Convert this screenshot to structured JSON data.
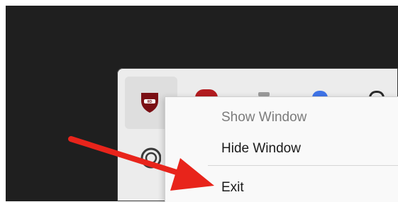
{
  "menu": {
    "items": [
      {
        "label": "Show Window",
        "enabled": false
      },
      {
        "label": "Hide Window",
        "enabled": true
      },
      {
        "label": "Exit",
        "enabled": true
      }
    ]
  },
  "tray": {
    "icons": [
      "shield-app-icon",
      "red-app-icon",
      "gray-app-icon",
      "blue-app-icon",
      "spiral-app-icon",
      "spiral-app-icon-2"
    ]
  },
  "annotation": {
    "type": "arrow",
    "color": "#e8241b",
    "points_to": "Exit"
  },
  "colors": {
    "desktop": "#1f1f1f",
    "tray_panel": "#ececec",
    "menu": "#f9f9f9"
  }
}
